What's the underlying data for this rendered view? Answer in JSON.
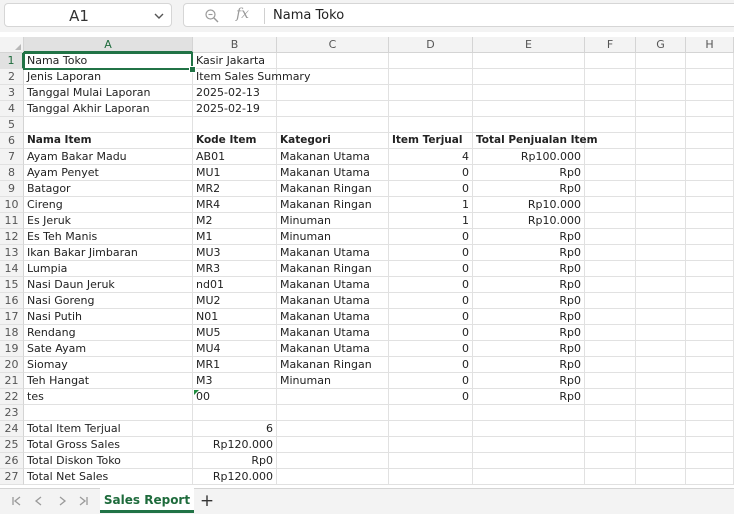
{
  "formula_bar": {
    "name_box": "A1",
    "fx_label": "fx",
    "formula": "Nama Toko"
  },
  "columns": [
    "A",
    "B",
    "C",
    "D",
    "E",
    "F",
    "G",
    "H"
  ],
  "rows": [
    {
      "n": "1",
      "cells": [
        "Nama Toko",
        "Kasir Jakarta",
        "",
        "",
        ""
      ]
    },
    {
      "n": "2",
      "cells": [
        "Jenis Laporan",
        "Item Sales Summary",
        "",
        "",
        ""
      ]
    },
    {
      "n": "3",
      "cells": [
        "Tanggal Mulai Laporan",
        "2025-02-13",
        "",
        "",
        ""
      ]
    },
    {
      "n": "4",
      "cells": [
        "Tanggal Akhir Laporan",
        "2025-02-19",
        "",
        "",
        ""
      ]
    },
    {
      "n": "5",
      "cells": [
        "",
        "",
        "",
        "",
        ""
      ]
    },
    {
      "n": "6",
      "cells": [
        "Nama Item",
        "Kode Item",
        "Kategori",
        "Item Terjual",
        "Total Penjualan Item"
      ],
      "bold": true
    },
    {
      "n": "7",
      "cells": [
        "Ayam Bakar Madu",
        "AB01",
        "Makanan Utama",
        "4",
        "Rp100.000"
      ]
    },
    {
      "n": "8",
      "cells": [
        "Ayam Penyet",
        "MU1",
        "Makanan Utama",
        "0",
        "Rp0"
      ]
    },
    {
      "n": "9",
      "cells": [
        "Batagor",
        "MR2",
        "Makanan Ringan",
        "0",
        "Rp0"
      ]
    },
    {
      "n": "10",
      "cells": [
        "Cireng",
        "MR4",
        "Makanan Ringan",
        "1",
        "Rp10.000"
      ]
    },
    {
      "n": "11",
      "cells": [
        "Es Jeruk",
        "M2",
        "Minuman",
        "1",
        "Rp10.000"
      ]
    },
    {
      "n": "12",
      "cells": [
        "Es Teh Manis",
        "M1",
        "Minuman",
        "0",
        "Rp0"
      ]
    },
    {
      "n": "13",
      "cells": [
        "Ikan Bakar Jimbaran",
        "MU3",
        "Makanan Utama",
        "0",
        "Rp0"
      ]
    },
    {
      "n": "14",
      "cells": [
        "Lumpia",
        "MR3",
        "Makanan Ringan",
        "0",
        "Rp0"
      ]
    },
    {
      "n": "15",
      "cells": [
        "Nasi Daun Jeruk",
        "nd01",
        "Makanan Utama",
        "0",
        "Rp0"
      ]
    },
    {
      "n": "16",
      "cells": [
        "Nasi Goreng",
        "MU2",
        "Makanan Utama",
        "0",
        "Rp0"
      ]
    },
    {
      "n": "17",
      "cells": [
        "Nasi Putih",
        "N01",
        "Makanan Utama",
        "0",
        "Rp0"
      ]
    },
    {
      "n": "18",
      "cells": [
        "Rendang",
        "MU5",
        "Makanan Utama",
        "0",
        "Rp0"
      ]
    },
    {
      "n": "19",
      "cells": [
        "Sate Ayam",
        "MU4",
        "Makanan Utama",
        "0",
        "Rp0"
      ]
    },
    {
      "n": "20",
      "cells": [
        "Siomay",
        "MR1",
        "Makanan Ringan",
        "0",
        "Rp0"
      ]
    },
    {
      "n": "21",
      "cells": [
        "Teh Hangat",
        "M3",
        "Minuman",
        "0",
        "Rp0"
      ]
    },
    {
      "n": "22",
      "cells": [
        "tes",
        "00",
        "",
        "0",
        "Rp0"
      ],
      "error_b": true
    },
    {
      "n": "23",
      "cells": [
        "",
        "",
        "",
        "",
        ""
      ]
    },
    {
      "n": "24",
      "cells": [
        "Total Item Terjual",
        "6",
        "",
        "",
        ""
      ],
      "num_b": true
    },
    {
      "n": "25",
      "cells": [
        "Total Gross Sales",
        "Rp120.000",
        "",
        "",
        ""
      ],
      "num_b": true
    },
    {
      "n": "26",
      "cells": [
        "Total Diskon Toko",
        "Rp0",
        "",
        "",
        ""
      ],
      "num_b": true
    },
    {
      "n": "27",
      "cells": [
        "Total Net Sales",
        "Rp120.000",
        "",
        "",
        ""
      ],
      "num_b": true
    }
  ],
  "tabs": {
    "sheets": [
      "Sales Report"
    ],
    "active": "Sales Report",
    "add_label": "+"
  },
  "colors": {
    "accent": "#217346",
    "tab_text": "#1e6b3c"
  }
}
